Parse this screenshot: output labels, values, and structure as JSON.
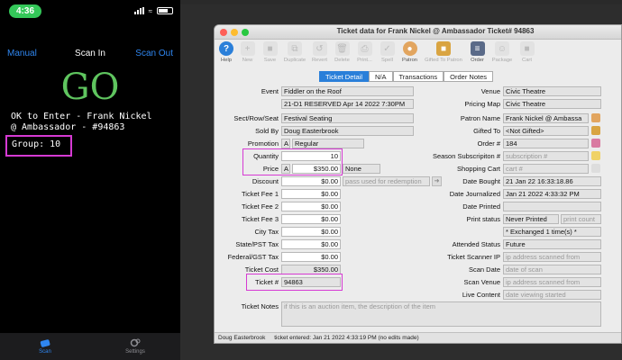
{
  "phone": {
    "time": "4:36",
    "nav": {
      "left": "Manual",
      "title": "Scan In",
      "right": "Scan Out"
    },
    "go": "GO",
    "message": "OK to Enter - Frank Nickel\n@ Ambassador - #94863",
    "group": "Group: 10",
    "tabs": {
      "scan": "Scan",
      "settings": "Settings"
    }
  },
  "window": {
    "title": "Ticket data for Frank Nickel @ Ambassador Ticket# 94863",
    "toolbar": [
      "Help",
      "New",
      "Save",
      "Duplicate",
      "Revert",
      "Delete",
      "Print...",
      "Spell",
      "Patron",
      "Gifted To Patron",
      "Order",
      "Package",
      "Cart"
    ],
    "tabs": [
      "Ticket Detail",
      "N/A",
      "Transactions",
      "Order Notes"
    ],
    "left": {
      "event_label": "Event",
      "event": "Fiddler on the Roof",
      "performance": "21-D1 RESERVED Apr 14 2022 7:30PM",
      "sect_label": "Sect/Row/Seat",
      "sect": "Festival Seating",
      "soldby_label": "Sold By",
      "soldby": "Doug Easterbrook",
      "promo_label": "Promotion",
      "promo_code": "A",
      "promo": "Regular",
      "qty_label": "Quantity",
      "qty": "10",
      "price_label": "Price",
      "price_code": "A",
      "price": "$350.00",
      "price_note": "None",
      "discount_label": "Discount",
      "discount": "$0.00",
      "discount_ph": "pass used for redemption",
      "fee1_label": "Ticket Fee 1",
      "fee1": "$0.00",
      "fee2_label": "Ticket Fee 2",
      "fee2": "$0.00",
      "fee3_label": "Ticket Fee 3",
      "fee3": "$0.00",
      "city_label": "City Tax",
      "city": "$0.00",
      "state_label": "State/PST Tax",
      "state": "$0.00",
      "fed_label": "Federal/GST Tax",
      "fed": "$0.00",
      "cost_label": "Ticket Cost",
      "cost": "$350.00",
      "ticketno_label": "Ticket #",
      "ticketno": "94863"
    },
    "right": {
      "venue_label": "Venue",
      "venue": "Civic Theatre",
      "map_label": "Pricing Map",
      "map": "Civic Theatre",
      "patron_label": "Patron Name",
      "patron": "Frank Nickel @ Ambassa",
      "gifted_label": "Gifted To",
      "gifted": "<Not Gifted>",
      "order_label": "Order #",
      "order": "184",
      "season_label": "Season Subscripiton #",
      "season_ph": "subscription #",
      "cart_label": "Shopping Cart",
      "cart_ph": "cart #",
      "bought_label": "Date Bought",
      "bought": "21 Jan 22  16:33:18.86",
      "journal_label": "Date Journalized",
      "journal": "Jan 21 2022  4:33:32 PM",
      "printed_label": "Date Printed",
      "pstatus_label": "Print status",
      "pstatus": "Never Printed",
      "pcount_ph": "print count",
      "exchanged": "* Exchanged 1 time(s) *",
      "attended_label": "Attended Status",
      "attended": "Future",
      "scannerip_label": "Ticket Scanner IP",
      "scannerip_ph": "ip address scanned from",
      "scandate_label": "Scan Date",
      "scandate_ph": "date of scan",
      "scanvenue_label": "Scan Venue",
      "scanvenue_ph": "ip address scanned from",
      "live_label": "Live Content",
      "live_ph": "date viewing started"
    },
    "notes_label": "Ticket Notes",
    "notes_ph": "if this is an auction item, the description of the item",
    "footer": {
      "user": "Doug Easterbrook",
      "entered": "ticket entered: Jan 21 2022 4:33:19 PM (no edits made)"
    }
  }
}
